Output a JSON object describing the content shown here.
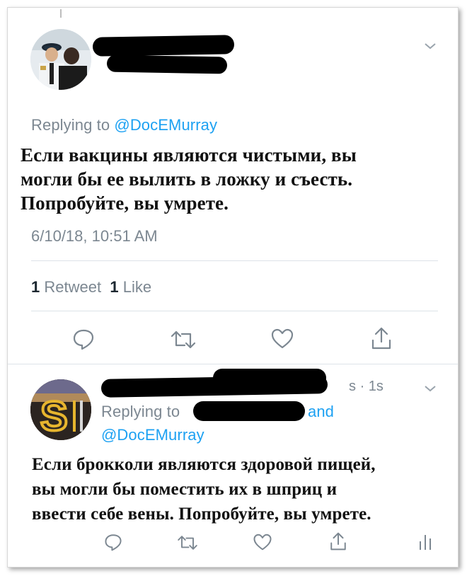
{
  "tweet1": {
    "replying_prefix": "Replying to ",
    "replying_handle": "@DocEMurray",
    "text_lines": [
      "Если вакцины являются чистыми, вы",
      "могли бы ее вылить в ложку и съесть.",
      "Попробуйте, вы умрете."
    ],
    "timestamp": "6/10/18, 10:51 AM",
    "retweet_count": "1",
    "retweet_label": "Retweet",
    "like_count": "1",
    "like_label": "Like",
    "actions": [
      "reply-icon",
      "retweet-icon",
      "like-icon",
      "share-icon"
    ]
  },
  "tweet2": {
    "time_ago": "· 1s",
    "name_fragment": "s",
    "replying_prefix": "Replying to",
    "and_label": "and",
    "replying_handle": "@DocEMurray",
    "text_lines": [
      "Если брокколи являются здоровой пищей,",
      "вы могли бы поместить их в шприц и",
      "ввести себе вены. Попробуйте, вы умрете."
    ],
    "actions": [
      "reply-icon",
      "retweet-icon",
      "like-icon",
      "share-icon",
      "analytics-icon"
    ]
  },
  "colors": {
    "link": "#1da1f2",
    "muted": "#7c8791",
    "icon": "#7c8791",
    "redaction": "#000000"
  }
}
